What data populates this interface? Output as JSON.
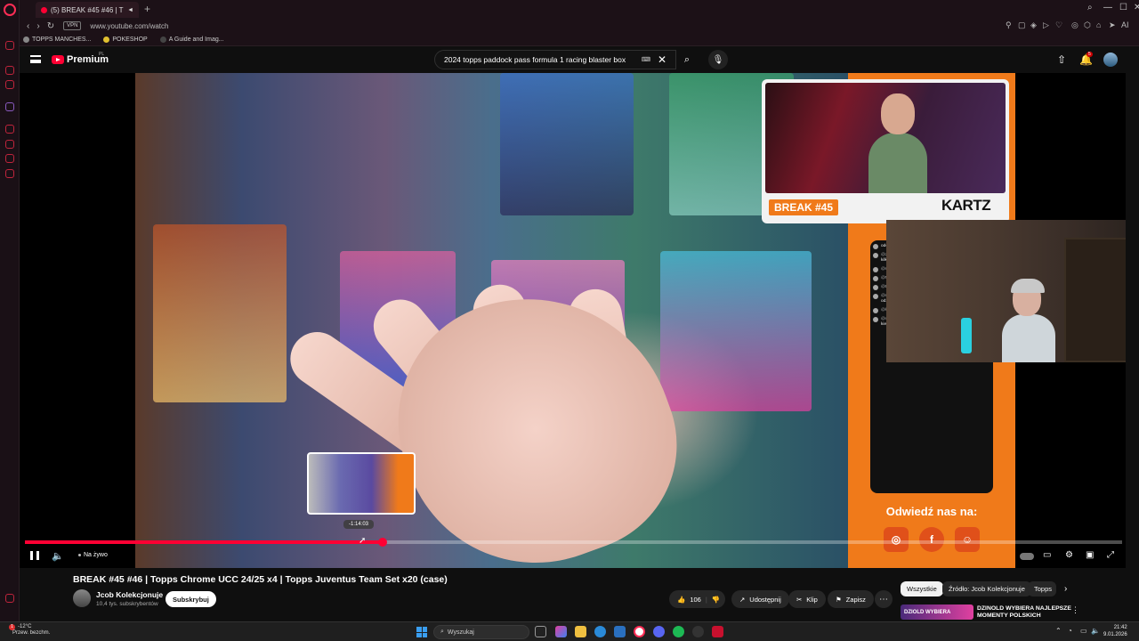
{
  "browser": {
    "tab_title": "(5) BREAK #45 #46 | T",
    "url": "www.youtube.com/watch",
    "vpn_label": "VPN",
    "bookmarks": [
      "TOPPS MANCHES...",
      "POKESHOP",
      "A Guide and Imag..."
    ],
    "ai_label": "AI"
  },
  "youtube": {
    "brand": "Premium",
    "region": "PL",
    "search_query": "2024 topps paddock pass formula 1 racing blaster box",
    "notification_count": "5"
  },
  "player": {
    "progress_fraction": 0.326,
    "buffered_fraction": 0.326,
    "preview_time": "-1:14:03",
    "live_label": "Na żywo",
    "overlay": {
      "break_label": "BREAK #45",
      "brand": "KARTZ",
      "visit_text": "Odwiedź nas na:",
      "chat": [
        {
          "user": "",
          "text": "odcl) i dałaj się tym jarzemy ja dorodź"
        },
        {
          "user": "@zoobs_dziga1783",
          "text": "hej, pisałe na instalacji Kartz , mam kilka fajnych kart do oddania :)"
        },
        {
          "user": "@nnmerolo05",
          "text": "@Kamyk40 gotowe na marble w niedziele"
        },
        {
          "user": "@Maczyk21",
          "text": ""
        },
        {
          "user": "@Deep99",
          "text": "No Kamyk wczoraj swoje trafił 😂😂"
        },
        {
          "user": "@mickskur99421",
          "text": "Spodziewam się że takiego dobrego odzewu zakończowsowania kartami?"
        },
        {
          "user": "@kaczorkrzysztof1766",
          "text": "ja boxy z auto polecacie"
        },
        {
          "user": "@ozymok13",
          "text": "Czy gdzieś wcześniej można się dowiedzieć kiedy będzie dany break dostępny na stronie? 😃"
        }
      ]
    }
  },
  "video": {
    "title": "BREAK #45 #46 | Topps Chrome UCC 24/25 x4 | Topps Juventus Team Set x20 (case)",
    "channel": "Jcob Kolekcjonuje",
    "subscribers": "10,4 tys. subskrybentów",
    "subscribe_label": "Subskrybuj",
    "likes": "106",
    "share_label": "Udostępnij",
    "clip_label": "Klip",
    "save_label": "Zapisz"
  },
  "sidebar_chips": [
    "Wszystkie",
    "Źródło: Jcob Kolekcjonuje",
    "Topps"
  ],
  "recommendation": {
    "thumb_text": "DZIOLD WYBIERA",
    "title": "DZINOLD WYBIERA NAJLEPSZE MOMENTY POLSKICH"
  },
  "taskbar": {
    "weather_temp": "-12°C",
    "weather_desc": "Przew. bezchm.",
    "weather_badge": "1",
    "search_placeholder": "Wyszukaj",
    "time": "21:42",
    "date": "9.01.2026"
  },
  "colors": {
    "yt_red": "#ff0033",
    "overlay_orange": "#f07a1a",
    "opera_red": "#ff2d55"
  }
}
